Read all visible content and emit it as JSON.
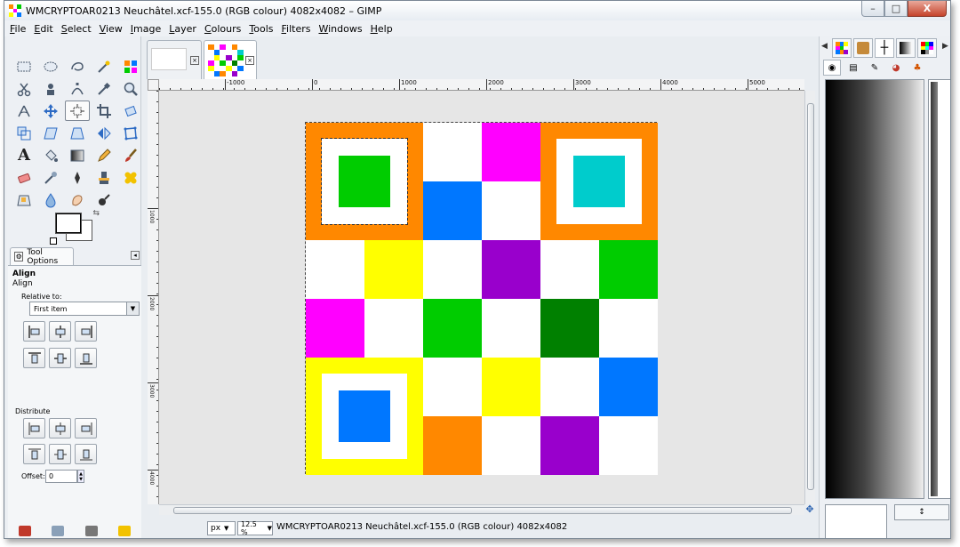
{
  "window": {
    "title": "WMCRYPTOAR0213 Neuchâtel.xcf-155.0 (RGB colour) 4082x4082 – GIMP",
    "controls": {
      "minimize": "–",
      "maximize": "□",
      "close": "X"
    }
  },
  "menubar": {
    "items": [
      {
        "u": "F",
        "rest": "ile"
      },
      {
        "u": "E",
        "rest": "dit"
      },
      {
        "u": "S",
        "rest": "elect"
      },
      {
        "u": "V",
        "rest": "iew"
      },
      {
        "u": "I",
        "rest": "mage"
      },
      {
        "u": "L",
        "rest": "ayer"
      },
      {
        "u": "C",
        "rest": "olours"
      },
      {
        "u": "T",
        "rest": "ools"
      },
      {
        "u": "F",
        "rest": "ilters"
      },
      {
        "u": "W",
        "rest": "indows"
      },
      {
        "u": "H",
        "rest": "elp"
      }
    ]
  },
  "tool_options": {
    "tab_label": "Tool Options",
    "title": "Align",
    "subtitle": "Align",
    "relative_to_label": "Relative to:",
    "relative_to_value": "First item",
    "distribute_label": "Distribute",
    "offset_label": "Offset:",
    "offset_value": "0"
  },
  "ruler": {
    "top_labels": [
      "-1000",
      "0",
      "1000",
      "2000",
      "3000",
      "4000",
      "5000"
    ],
    "left_labels": [
      "1000",
      "2000",
      "3000",
      "4000"
    ]
  },
  "statusbar": {
    "unit": "px",
    "zoom": "12.5 %",
    "text": "WMCRYPTOAR0213 Neuchâtel.xcf-155.0 (RGB colour) 4082x4082"
  },
  "image_grid": {
    "colors": {
      "orange": "#ff8800",
      "green": "#00cc00",
      "cyan": "#00cccc",
      "blue": "#0077ff",
      "magenta": "#ff00ff",
      "yellow": "#ffff00",
      "purple": "#9900cc",
      "darkgreen": "#008000",
      "white": "#ffffff"
    },
    "rows": [
      [
        "white",
        "white",
        "white",
        "magenta",
        "white",
        "white"
      ],
      [
        "white",
        "white",
        "blue",
        "white",
        "white",
        "white"
      ],
      [
        "white",
        "yellow",
        "white",
        "purple",
        "white",
        "green"
      ],
      [
        "magenta",
        "white",
        "green",
        "white",
        "darkgreen",
        "white"
      ],
      [
        "white",
        "white",
        "white",
        "yellow",
        "white",
        "blue"
      ],
      [
        "white",
        "white",
        "orange",
        "white",
        "purple",
        "white"
      ]
    ],
    "finder_patterns": [
      {
        "name": "top-left",
        "outer": "orange",
        "inner": "green"
      },
      {
        "name": "top-right",
        "outer": "orange",
        "inner": "cyan"
      },
      {
        "name": "bottom-left",
        "outer": "yellow",
        "inner": "blue"
      }
    ]
  },
  "dock": {
    "bottom_button": "↕"
  }
}
